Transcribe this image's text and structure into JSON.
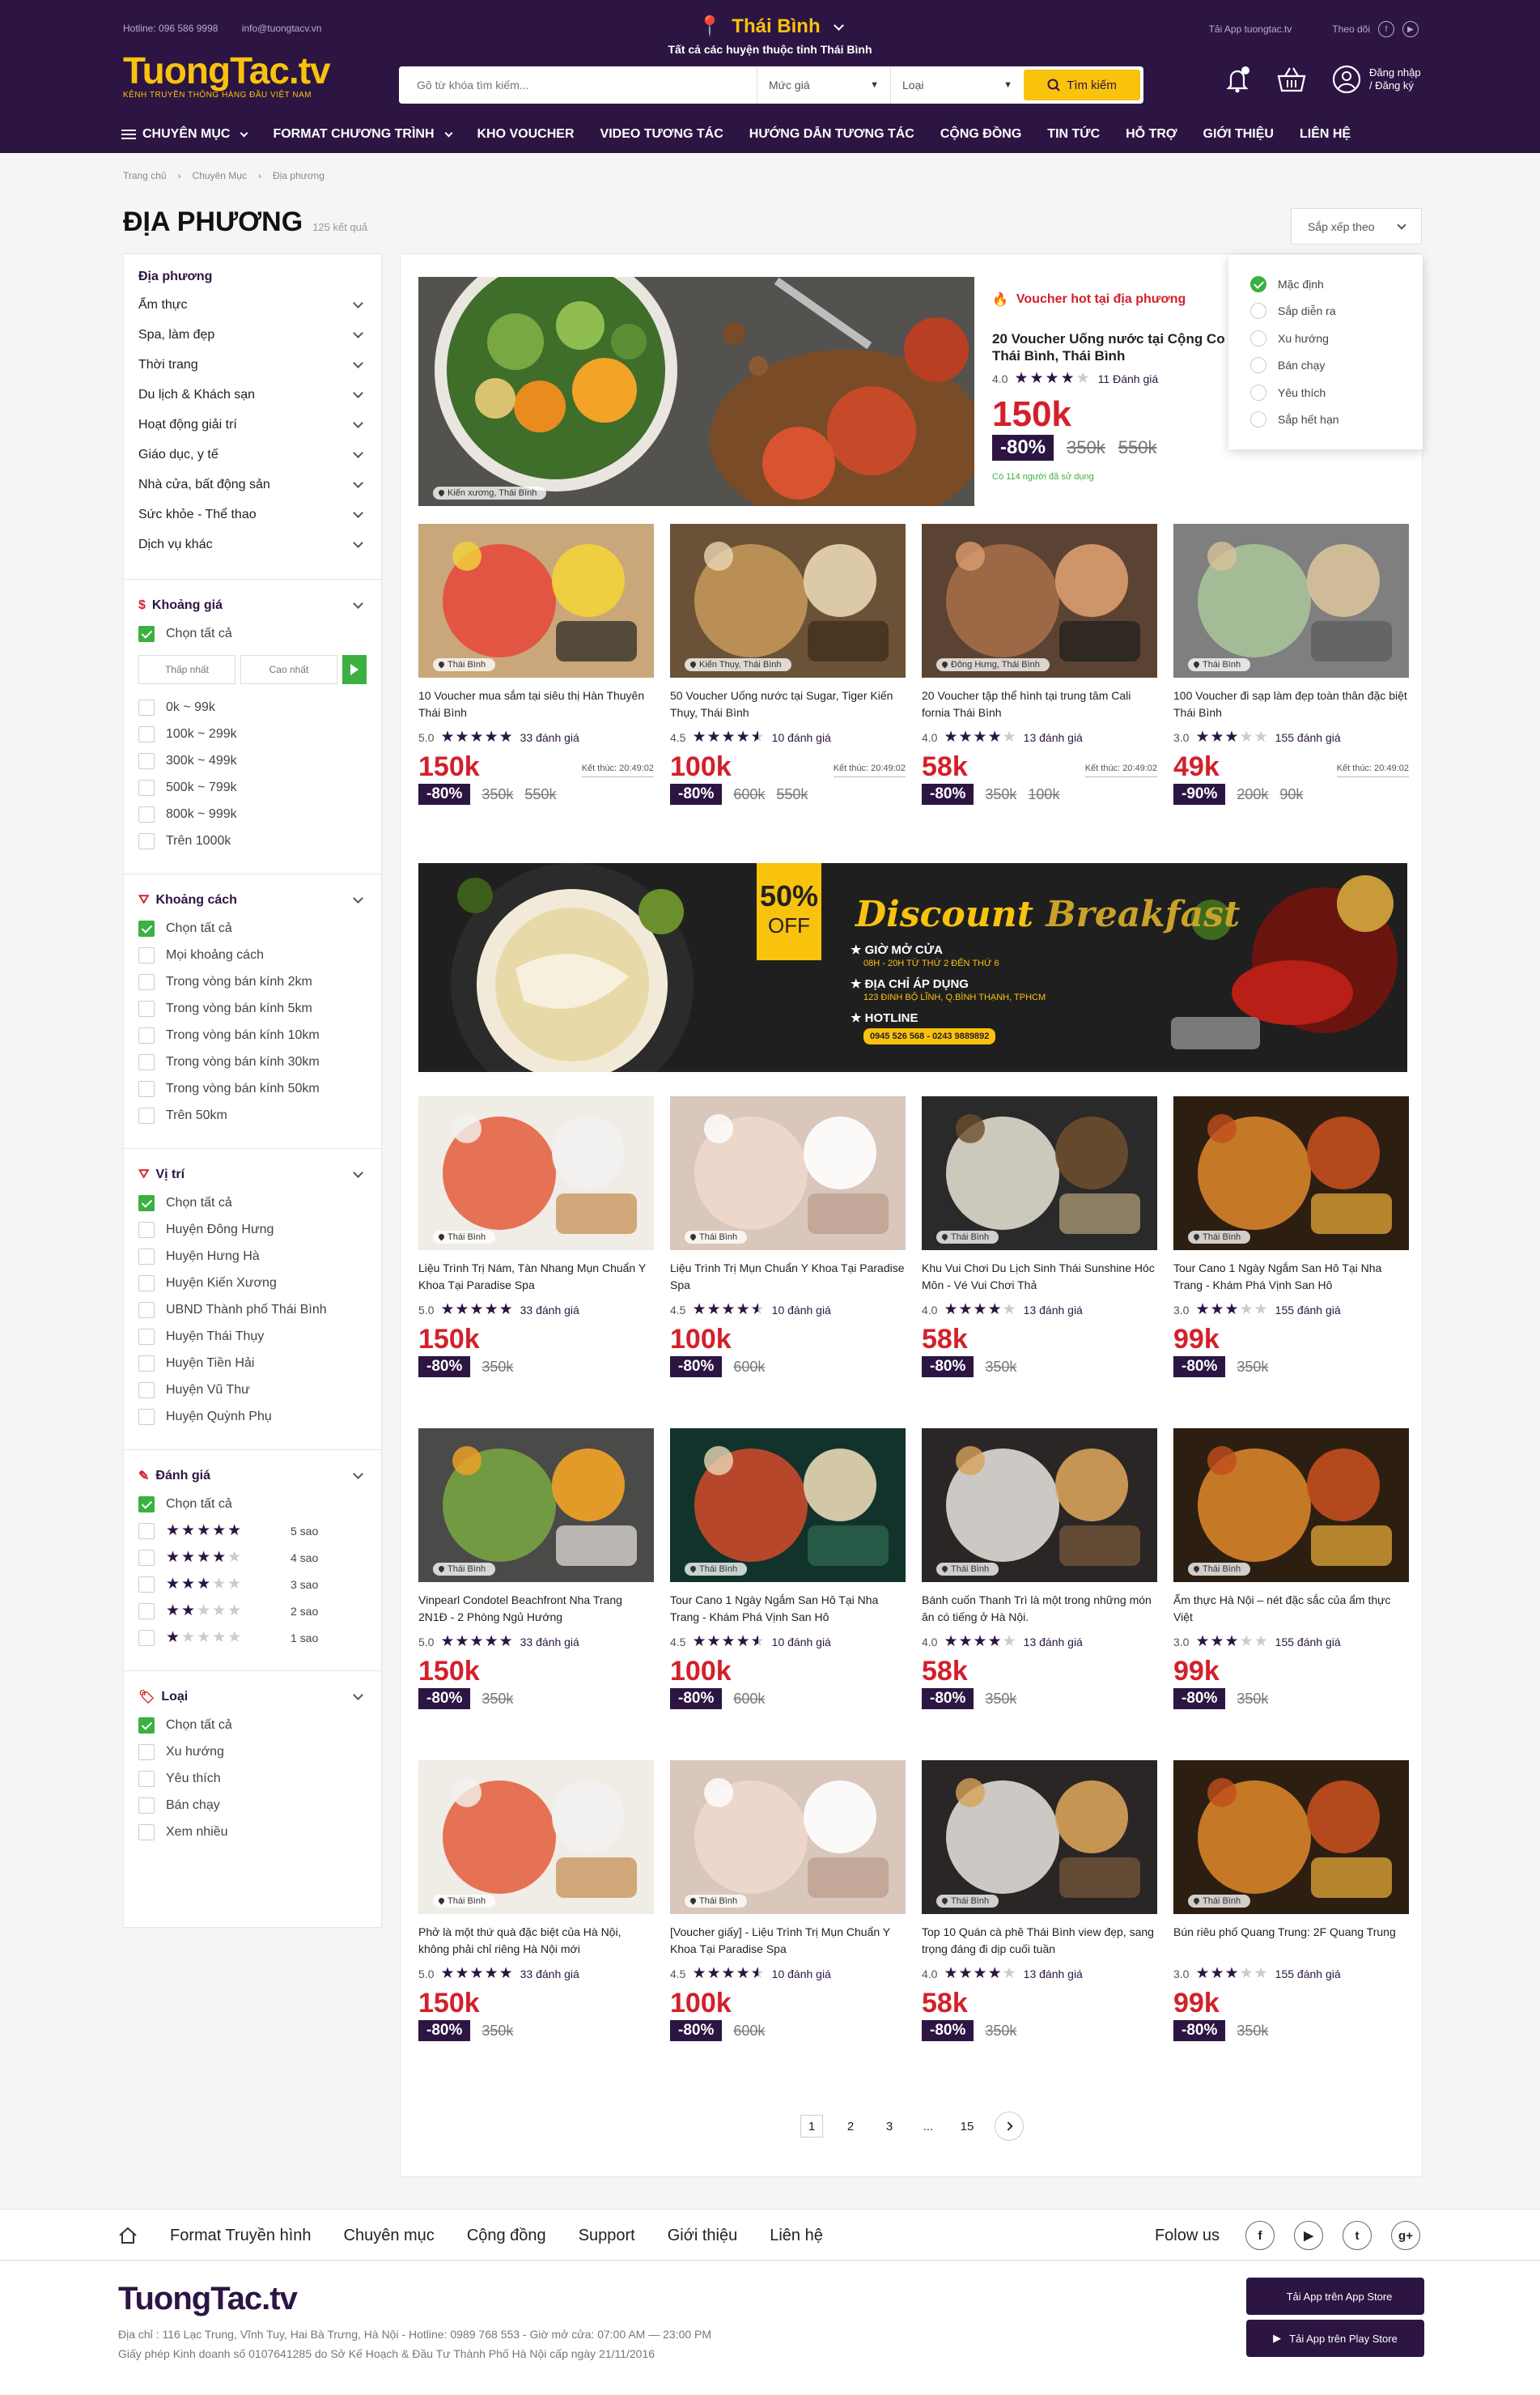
{
  "header": {
    "hotline": "Hotline: 096 586 9998",
    "email": "info@tuongtacv.vn",
    "city": "Thái Bình",
    "city_sub": "Tất cả các huyện thuộc tỉnh Thái Bình",
    "app_link": "Tải App tuongtac.tv",
    "follow": "Theo dõi",
    "logo": "TuongTac.tv",
    "slogan": "KÊNH TRUYỀN THÔNG HÀNG ĐẦU VIỆT NAM",
    "search_placeholder": "Gõ từ khóa tìm kiếm...",
    "price_select": "Mức giá",
    "type_select": "Loại",
    "search_button": "Tìm kiếm",
    "login_line1": "Đăng nhập",
    "login_line2": "/ Đăng ký",
    "nav": [
      "CHUYÊN MỤC",
      "FORMAT CHƯƠNG TRÌNH",
      "KHO VOUCHER",
      "VIDEO TƯƠNG TÁC",
      "HƯỚNG DẪN TƯƠNG TÁC",
      "CỘNG ĐỒNG",
      "TIN TỨC",
      "HỖ TRỢ",
      "GIỚI THIỆU",
      "LIÊN HỆ"
    ]
  },
  "breadcrumb": [
    "Trang chủ",
    "Chuyên Mục",
    "Địa phương"
  ],
  "page": {
    "title": "ĐỊA PHƯƠNG",
    "count": "125 kết quả",
    "sort_label": "Sắp xếp theo",
    "sort_options": [
      "Mặc định",
      "Sắp diễn ra",
      "Xu hướng",
      "Bán chạy",
      "Yêu thích",
      "Sắp hết hạn"
    ]
  },
  "sidebar": {
    "categories_title": "Địa phương",
    "categories": [
      "Ẩm thực",
      "Spa, làm đẹp",
      "Thời trang",
      "Du lịch & Khách sạn",
      "Hoạt động giải trí",
      "Giáo dục, y tế",
      "Nhà cửa, bất động sản",
      "Sức khỏe - Thể thao",
      "Dịch vụ khác"
    ],
    "price": {
      "title": "Khoảng giá",
      "all": "Chọn tất cả",
      "min_placeholder": "Thấp nhất",
      "max_placeholder": "Cao nhất",
      "options": [
        "0k ~ 99k",
        "100k ~ 299k",
        "300k ~ 499k",
        "500k ~ 799k",
        "800k ~ 999k",
        "Trên 1000k"
      ]
    },
    "distance": {
      "title": "Khoảng cách",
      "all": "Chọn tất cả",
      "options": [
        "Mọi khoảng cách",
        "Trong vòng bán kính 2km",
        "Trong vòng bán kính 5km",
        "Trong vòng bán kính 10km",
        "Trong vòng bán kính 30km",
        "Trong vòng bán kính 50km",
        "Trên 50km"
      ]
    },
    "location": {
      "title": "Vị trí",
      "all": "Chọn tất cả",
      "options": [
        "Huyện Đông Hưng",
        "Huyện Hưng Hà",
        "Huyện Kiến Xương",
        "UBND Thành phố Thái Bình",
        "Huyện Thái Thụy",
        "Huyện Tiền Hải",
        "Huyện Vũ Thư",
        "Huyện Quỳnh Phụ"
      ]
    },
    "rating": {
      "title": "Đánh giá",
      "all": "Chọn tất cả",
      "options": [
        {
          "stars": 5,
          "label": "5 sao"
        },
        {
          "stars": 4,
          "label": "4 sao"
        },
        {
          "stars": 3,
          "label": "3 sao"
        },
        {
          "stars": 2,
          "label": "2 sao"
        },
        {
          "stars": 1,
          "label": "1 sao"
        }
      ]
    },
    "type": {
      "title": "Loại",
      "all": "Chọn tất cả",
      "options": [
        "Xu hướng",
        "Yêu thích",
        "Bán chạy",
        "Xem nhiều"
      ]
    }
  },
  "featured": {
    "badge": "Voucher hot tại địa phương",
    "title": "20 Voucher Uống nước tại Cộng Co Thái Bình, Thái Bình",
    "rating": "4.0",
    "stars": 4,
    "reviews": "11 Đánh giá",
    "price": "150k",
    "discount": "-80%",
    "old1": "350k",
    "old2": "550k",
    "used": "Có 114 người đã sử dụng",
    "location": "Kiến xương, Thái Bình"
  },
  "row1": [
    {
      "title": "10 Voucher mua sắm tại siêu thị Hàn Thuyên Thái Bình",
      "rating": "5.0",
      "stars": 5,
      "reviews": "33 đánh giá",
      "price": "150k",
      "end": "Kết thúc: 20:49:02",
      "discount": "-80%",
      "old1": "350k",
      "old2": "550k",
      "location": "Thái Bình"
    },
    {
      "title": "50 Voucher Uống nước tại Sugar, Tiger Kiến Thụy, Thái Bình",
      "rating": "4.5",
      "stars": 4.5,
      "reviews": "10 đánh giá",
      "price": "100k",
      "end": "Kết thúc: 20:49:02",
      "discount": "-80%",
      "old1": "600k",
      "old2": "550k",
      "location": "Kiến Thụy, Thái Bình"
    },
    {
      "title": "20 Voucher tập thể hình tại trung tâm Cali fornia Thái Bình",
      "rating": "4.0",
      "stars": 4,
      "reviews": "13 đánh giá",
      "price": "58k",
      "end": "Kết thúc: 20:49:02",
      "discount": "-80%",
      "old1": "350k",
      "old2": "100k",
      "location": "Đông Hưng, Thái Bình"
    },
    {
      "title": "100 Voucher đi sạp làm đẹp toàn thân đặc biệt Thái Bình",
      "rating": "3.0",
      "stars": 3,
      "reviews": "155 đánh giá",
      "price": "49k",
      "end": "Kết thúc: 20:49:02",
      "discount": "-90%",
      "old1": "200k",
      "old2": "90k",
      "location": "Thái Bình"
    }
  ],
  "banner": {
    "percent": "50%",
    "off": "OFF",
    "word1": "Discount",
    "word2": "Breakfast",
    "hours_label": "GIỜ MỞ CỬA",
    "hours": "08H - 20H TỪ THỨ 2 ĐẾN THỨ 6",
    "addr_label": "ĐỊA CHỈ ÁP DỤNG",
    "addr": "123 ĐINH BỘ LĨNH, Q.BÌNH THẠNH, TPHCM",
    "hotline_label": "HOTLINE",
    "hotline": "0945 526 568 - 0243 9889892"
  },
  "row2": [
    {
      "title": "Liệu Trình Trị Nám, Tàn Nhang Mụn Chuẩn Y Khoa Tại Paradise Spa",
      "rating": "5.0",
      "stars": 5,
      "reviews": "33 đánh giá",
      "price": "150k",
      "discount": "-80%",
      "old1": "350k",
      "location": "Thái Bình"
    },
    {
      "title": "Liệu Trình Trị Mụn Chuẩn Y Khoa Tại Paradise Spa",
      "rating": "4.5",
      "stars": 4.5,
      "reviews": "10 đánh giá",
      "price": "100k",
      "discount": "-80%",
      "old1": "600k",
      "location": "Thái Bình"
    },
    {
      "title": "Khu Vui Chơi Du Lịch Sinh Thái Sunshine Hóc Môn - Vé Vui Chơi Thả",
      "rating": "4.0",
      "stars": 4,
      "reviews": "13 đánh giá",
      "price": "58k",
      "discount": "-80%",
      "old1": "350k",
      "location": "Thái Bình"
    },
    {
      "title": "Tour Cano 1 Ngày Ngắm San Hô Tại Nha Trang - Khám Phá Vịnh San Hô",
      "rating": "3.0",
      "stars": 3,
      "reviews": "155 đánh giá",
      "price": "99k",
      "discount": "-80%",
      "old1": "350k",
      "location": "Thái Bình"
    }
  ],
  "row3": [
    {
      "title": "Vinpearl Condotel Beachfront Nha Trang 2N1Đ - 2 Phòng Ngủ Hướng",
      "rating": "5.0",
      "stars": 5,
      "reviews": "33 đánh giá",
      "price": "150k",
      "discount": "-80%",
      "old1": "350k",
      "location": "Thái Bình"
    },
    {
      "title": "Tour Cano 1 Ngày Ngắm San Hô Tại Nha Trang - Khám Phá Vịnh San Hô",
      "rating": "4.5",
      "stars": 4.5,
      "reviews": "10 đánh giá",
      "price": "100k",
      "discount": "-80%",
      "old1": "600k",
      "location": "Thái Bình"
    },
    {
      "title": "Bánh cuốn Thanh Trì là một trong những món ăn có tiếng ở Hà Nội.",
      "rating": "4.0",
      "stars": 4,
      "reviews": "13 đánh giá",
      "price": "58k",
      "discount": "-80%",
      "old1": "350k",
      "location": "Thái Bình"
    },
    {
      "title": "Ẩm thực Hà Nội – nét đặc sắc của ẩm thực Việt",
      "rating": "3.0",
      "stars": 3,
      "reviews": "155 đánh giá",
      "price": "99k",
      "discount": "-80%",
      "old1": "350k",
      "location": "Thái Bình"
    }
  ],
  "row4": [
    {
      "title": "Phở là một thứ quà đặc biệt của Hà Nội, không phải chỉ riêng Hà Nội mới",
      "rating": "5.0",
      "stars": 5,
      "reviews": "33 đánh giá",
      "price": "150k",
      "discount": "-80%",
      "old1": "350k",
      "location": "Thái Bình"
    },
    {
      "title": "[Voucher giấy] - Liệu Trình Trị Mụn Chuẩn Y Khoa Tại Paradise Spa",
      "rating": "4.5",
      "stars": 4.5,
      "reviews": "10 đánh giá",
      "price": "100k",
      "discount": "-80%",
      "old1": "600k",
      "location": "Thái Bình"
    },
    {
      "title": "Top 10 Quán cà phê Thái Bình view đẹp, sang trọng đáng đi dịp cuối tuần",
      "rating": "4.0",
      "stars": 4,
      "reviews": "13 đánh giá",
      "price": "58k",
      "discount": "-80%",
      "old1": "350k",
      "location": "Thái Bình"
    },
    {
      "title": "Bún riêu phố Quang Trung: 2F Quang Trung",
      "rating": "3.0",
      "stars": 3,
      "reviews": "155 đánh giá",
      "price": "99k",
      "discount": "-80%",
      "old1": "350k",
      "location": "Thái Bình"
    }
  ],
  "pagination": [
    "1",
    "2",
    "3",
    "...",
    "15"
  ],
  "footer": {
    "links": [
      "Format Truyền hình",
      "Chuyên mục",
      "Cộng đồng",
      "Support",
      "Giới thiệu",
      "Liên hệ"
    ],
    "follow": "Folow us",
    "logo": "TuongTac.tv",
    "address": "Địa chỉ : 116 Lạc Trung, Vĩnh Tuy, Hai Bà Trưng, Hà Nội - Hotline: 0989 768 553  -  Giờ mở cửa: 07:00 AM — 23:00 PM",
    "license": "Giấy phép Kinh doanh số 0107641285 do Sở Kế Hoạch & Đầu Tư Thành Phố Hà Nội cấp ngày 21/11/2016",
    "appstore": "Tải App trên App Store",
    "playstore": "Tải App trên Play Store"
  }
}
